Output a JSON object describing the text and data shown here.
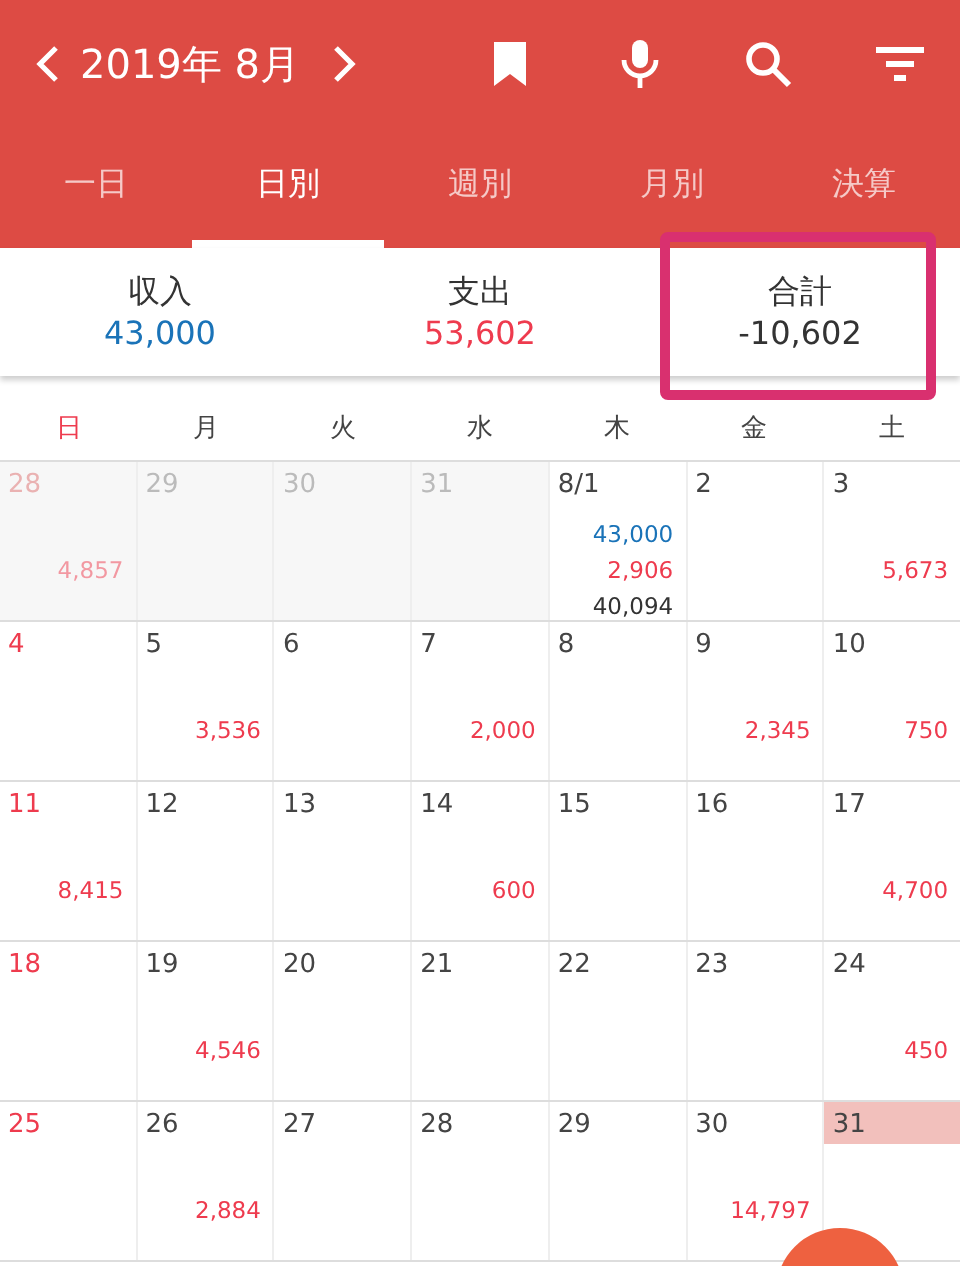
{
  "header": {
    "title": "2019年 8月"
  },
  "tabs": [
    {
      "label": "一日",
      "selected": false
    },
    {
      "label": "日別",
      "selected": true
    },
    {
      "label": "週別",
      "selected": false
    },
    {
      "label": "月別",
      "selected": false
    },
    {
      "label": "決算",
      "selected": false
    }
  ],
  "summary": [
    {
      "label": "収入",
      "value": "43,000",
      "kind": "income",
      "highlighted": false
    },
    {
      "label": "支出",
      "value": "53,602",
      "kind": "expense",
      "highlighted": false
    },
    {
      "label": "合計",
      "value": "-10,602",
      "kind": "total",
      "highlighted": true
    }
  ],
  "weekdays": [
    "日",
    "月",
    "火",
    "水",
    "木",
    "金",
    "土"
  ],
  "weeks": [
    [
      {
        "day": "28",
        "outside": true,
        "today": false,
        "expense": "4,857"
      },
      {
        "day": "29",
        "outside": true,
        "today": false
      },
      {
        "day": "30",
        "outside": true,
        "today": false
      },
      {
        "day": "31",
        "outside": true,
        "today": false
      },
      {
        "day": "8/1",
        "outside": false,
        "today": false,
        "income": "43,000",
        "expense": "2,906",
        "total": "40,094"
      },
      {
        "day": "2",
        "outside": false,
        "today": false
      },
      {
        "day": "3",
        "outside": false,
        "today": false,
        "expense": "5,673"
      }
    ],
    [
      {
        "day": "4",
        "outside": false,
        "today": false
      },
      {
        "day": "5",
        "outside": false,
        "today": false,
        "expense": "3,536"
      },
      {
        "day": "6",
        "outside": false,
        "today": false
      },
      {
        "day": "7",
        "outside": false,
        "today": false,
        "expense": "2,000"
      },
      {
        "day": "8",
        "outside": false,
        "today": false
      },
      {
        "day": "9",
        "outside": false,
        "today": false,
        "expense": "2,345"
      },
      {
        "day": "10",
        "outside": false,
        "today": false,
        "expense": "750"
      }
    ],
    [
      {
        "day": "11",
        "outside": false,
        "today": false,
        "expense": "8,415"
      },
      {
        "day": "12",
        "outside": false,
        "today": false
      },
      {
        "day": "13",
        "outside": false,
        "today": false
      },
      {
        "day": "14",
        "outside": false,
        "today": false,
        "expense": "600"
      },
      {
        "day": "15",
        "outside": false,
        "today": false
      },
      {
        "day": "16",
        "outside": false,
        "today": false
      },
      {
        "day": "17",
        "outside": false,
        "today": false,
        "expense": "4,700"
      }
    ],
    [
      {
        "day": "18",
        "outside": false,
        "today": false
      },
      {
        "day": "19",
        "outside": false,
        "today": false,
        "expense": "4,546"
      },
      {
        "day": "20",
        "outside": false,
        "today": false
      },
      {
        "day": "21",
        "outside": false,
        "today": false
      },
      {
        "day": "22",
        "outside": false,
        "today": false
      },
      {
        "day": "23",
        "outside": false,
        "today": false
      },
      {
        "day": "24",
        "outside": false,
        "today": false,
        "expense": "450"
      }
    ],
    [
      {
        "day": "25",
        "outside": false,
        "today": false
      },
      {
        "day": "26",
        "outside": false,
        "today": false,
        "expense": "2,884"
      },
      {
        "day": "27",
        "outside": false,
        "today": false
      },
      {
        "day": "28",
        "outside": false,
        "today": false
      },
      {
        "day": "29",
        "outside": false,
        "today": false
      },
      {
        "day": "30",
        "outside": false,
        "today": false,
        "expense": "14,797"
      },
      {
        "day": "31",
        "outside": false,
        "today": true
      }
    ]
  ]
}
